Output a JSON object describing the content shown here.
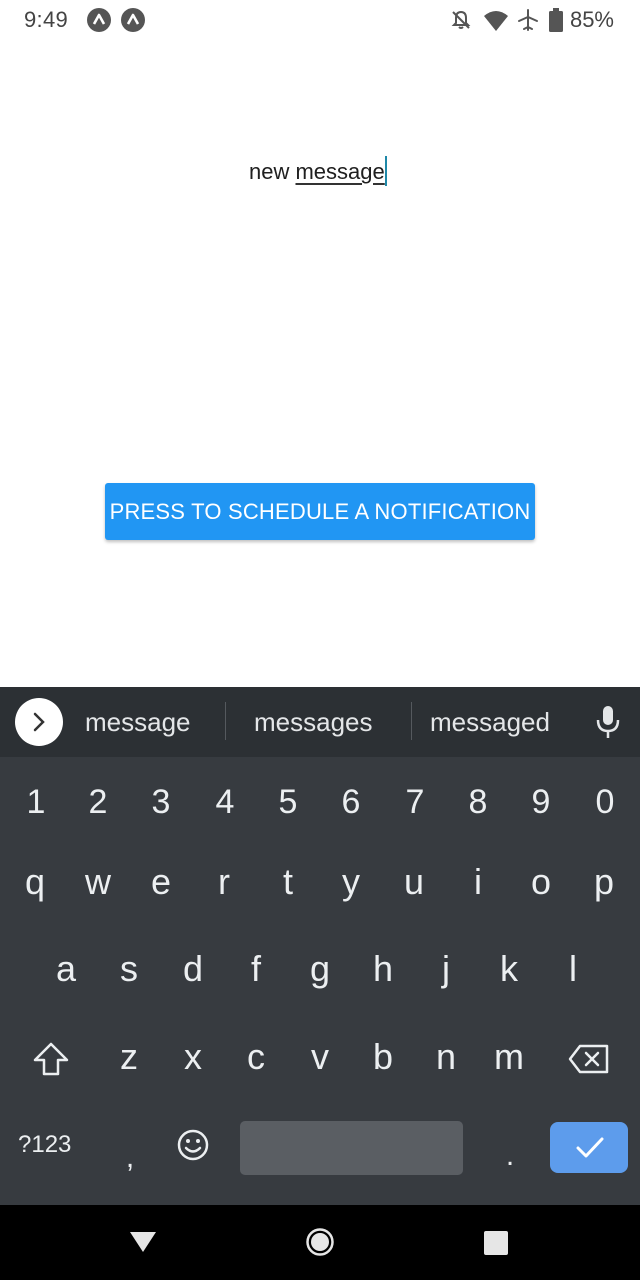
{
  "status_bar": {
    "time": "9:49",
    "battery_percent": "85%",
    "icons": [
      "app-notification-icon",
      "app-notification-icon",
      "notifications-off-icon",
      "wifi-icon",
      "airplane-mode-icon",
      "battery-icon"
    ]
  },
  "content": {
    "input_text_prefix": "new ",
    "input_text_composing": "message",
    "schedule_button_label": "PRESS TO SCHEDULE A NOTIFICATION",
    "button_color": "#2196f3"
  },
  "keyboard": {
    "suggestions": [
      "message",
      "messages",
      "messaged"
    ],
    "number_row": [
      "1",
      "2",
      "3",
      "4",
      "5",
      "6",
      "7",
      "8",
      "9",
      "0"
    ],
    "row1": [
      "q",
      "w",
      "e",
      "r",
      "t",
      "y",
      "u",
      "i",
      "o",
      "p"
    ],
    "row2": [
      "a",
      "s",
      "d",
      "f",
      "g",
      "h",
      "j",
      "k",
      "l"
    ],
    "row3": [
      "z",
      "x",
      "c",
      "v",
      "b",
      "n",
      "m"
    ],
    "symbols_label": "?123",
    "comma": ",",
    "period": ".",
    "enter_color": "#5d9cec"
  },
  "nav_bar": {
    "buttons": [
      "back-icon",
      "home-icon",
      "recents-icon"
    ]
  }
}
